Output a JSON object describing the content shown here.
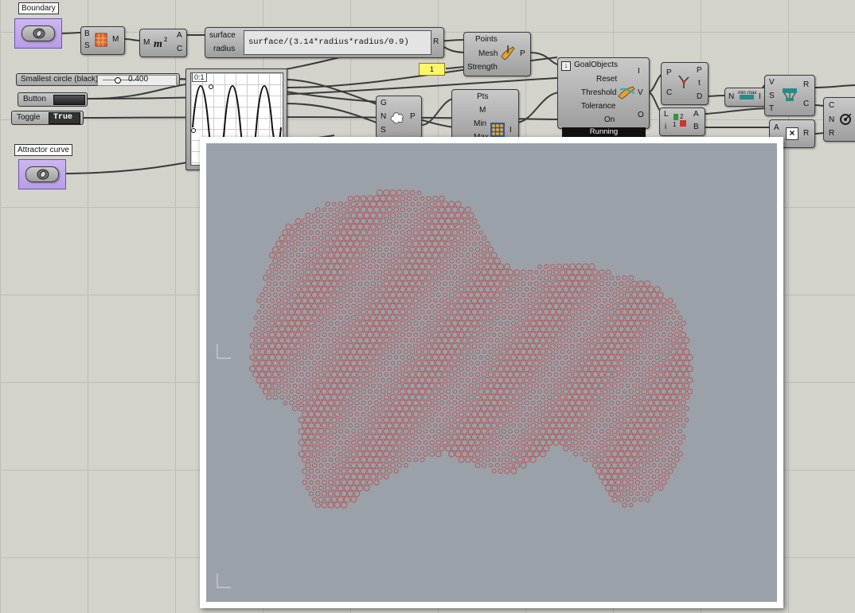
{
  "params": {
    "boundary_tag": "Boundary",
    "attractor_tag": "Attractor curve"
  },
  "inputs": {
    "slider_label": "Smallest circle (black)",
    "slider_value": "0.400",
    "slider_fraction": 0.4,
    "button_label": "Button",
    "toggle_label": "Toggle",
    "toggle_value": "True",
    "number_panel": "1"
  },
  "components": {
    "brep_inputs": [
      "B",
      "S"
    ],
    "brep_output": "M",
    "area_input": "M",
    "area_outputs": [
      "A",
      "C"
    ],
    "expr_inputs": [
      "surface",
      "radius"
    ],
    "expr_text": "surface/(3.14*radius*radius/0.9)",
    "expr_output": "R",
    "pts_on_mesh_inputs": [
      "Points",
      "Mesh",
      "Strength"
    ],
    "pts_on_mesh_output": "P",
    "graph_label": "0:1",
    "populate_inputs": [
      "G",
      "N",
      "S"
    ],
    "populate_output": "P",
    "closest_inputs": [
      "Pts",
      "M",
      "Min",
      "Max"
    ],
    "closest_output": "I",
    "kangaroo_inputs": [
      "GoalObjects",
      "Reset",
      "Threshold",
      "Tolerance",
      "On"
    ],
    "kangaroo_outputs": [
      "I",
      "V",
      "O"
    ],
    "kangaroo_status": "Running",
    "decon_inputs": [
      "P",
      "C"
    ],
    "decon_outputs": [
      "P",
      "t",
      "D"
    ],
    "bounds_input": "N",
    "bounds_output": "I",
    "list_inputs": [
      "L",
      "i"
    ],
    "list_outputs": [
      "A",
      "B"
    ],
    "remap_inputs": [
      "V",
      "S",
      "T"
    ],
    "remap_outputs": [
      "R",
      "C"
    ],
    "mult_input": "A",
    "mult_output": "R",
    "circle_inputs": [
      "C",
      "N",
      "R"
    ]
  },
  "icons": {
    "param": "curve-param-icon",
    "area": "area-icon",
    "brep": "brep-icon",
    "kangaroo": "kangaroo-icon",
    "populate": "cloud-icon",
    "circle": "circle-icon"
  },
  "colors": {
    "canvas": "#d3d3cc",
    "viewport_bg": "#9ba1a8",
    "circle_stroke": "#b35a5a",
    "param_fill": "#c3a8ee"
  }
}
